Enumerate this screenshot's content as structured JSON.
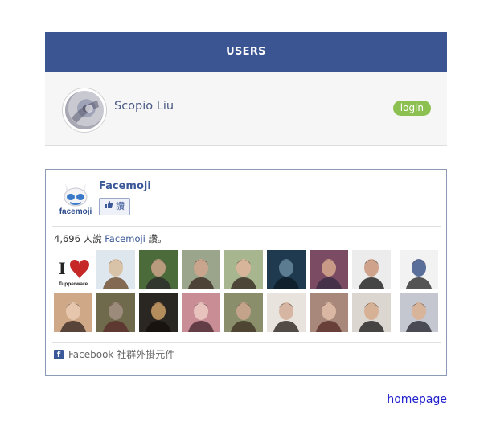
{
  "users_panel": {
    "header": "USERS",
    "user": {
      "name": "Scopio Liu",
      "login_label": "login"
    }
  },
  "facebook_widget": {
    "page_name": "Facemoji",
    "like_button_label": "讚",
    "like_count_prefix": "4,696 人說",
    "like_count_page": "Facemoji",
    "like_count_suffix": "讚。",
    "footer_label": "Facebook 社群外掛元件",
    "logo_text": "facemoji",
    "faces": [
      {
        "label": "Tupperware"
      },
      {
        "label": ""
      },
      {
        "label": ""
      },
      {
        "label": ""
      },
      {
        "label": ""
      },
      {
        "label": ""
      },
      {
        "label": ""
      },
      {
        "label": ""
      },
      {
        "label": ""
      },
      {
        "label": ""
      },
      {
        "label": ""
      },
      {
        "label": ""
      },
      {
        "label": ""
      },
      {
        "label": ""
      },
      {
        "label": ""
      },
      {
        "label": ""
      },
      {
        "label": ""
      },
      {
        "label": ""
      }
    ]
  },
  "footer": {
    "homepage_label": "homepage"
  },
  "colors": {
    "header_bg": "#3b5492",
    "login_bg": "#8cc152",
    "facebook_blue": "#3b5998",
    "link_blue": "#2222cc"
  }
}
